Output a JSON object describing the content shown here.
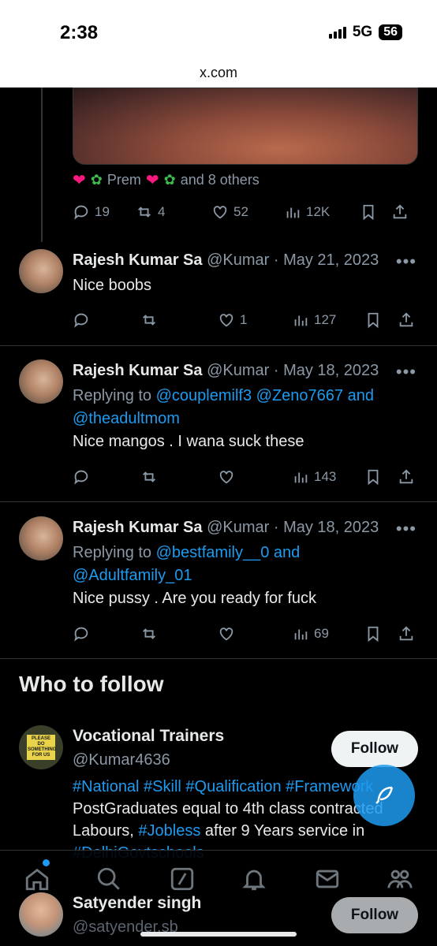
{
  "status_bar": {
    "time": "2:38",
    "network": "5G",
    "battery": "56"
  },
  "browser": {
    "url": "x.com"
  },
  "top_tweet": {
    "likers": {
      "name": "Prem",
      "suffix": "and 8 others"
    },
    "stats": {
      "replies": "19",
      "reposts": "4",
      "likes": "52",
      "views": "12K"
    }
  },
  "replies": [
    {
      "name": "Rajesh Kumar Sa",
      "handle": "@Kumar",
      "date": "· May 21, 2023",
      "text": "Nice boobs",
      "stats": {
        "replies": "",
        "reposts": "",
        "likes": "1",
        "views": "127"
      }
    },
    {
      "name": "Rajesh Kumar Sa",
      "handle": "@Kumar",
      "date": "· May 18, 2023",
      "replying_prefix": "Replying to",
      "replying_line1": "@couplemilf3 @Zeno7667 and",
      "replying_line2": "@theadultmom",
      "text": "Nice mangos . I wana suck these",
      "stats": {
        "replies": "",
        "reposts": "",
        "likes": "",
        "views": "143"
      }
    },
    {
      "name": "Rajesh Kumar Sa",
      "handle": "@Kumar",
      "date": "· May 18, 2023",
      "replying_prefix": "Replying to",
      "replying_line1": "@bestfamily__0 and",
      "replying_line2": "@Adultfamily_01",
      "text": "Nice pussy . Are you ready for fuck",
      "stats": {
        "replies": "",
        "reposts": "",
        "likes": "",
        "views": "69"
      }
    }
  ],
  "who_to_follow": {
    "title": "Who to follow",
    "follow_label": "Follow",
    "accounts": [
      {
        "name": "Vocational Trainers",
        "handle": "@Kumar4636",
        "avatar_text": "PLEASE DO SOMETHING FOR US",
        "bio_tags": "#National #Skill #Qualification #Framework",
        "bio_text_1": "PostGraduates equal to 4th class contracted",
        "bio_text_2": "Labours,",
        "bio_tag_2": "#Jobless",
        "bio_text_3": "after 9 Years service in",
        "bio_tag_3": "#DelhiGovtschools"
      },
      {
        "name": "Satyender singh",
        "handle": "@satyender.sb"
      }
    ]
  },
  "bottom_nav": [
    "home-icon",
    "search-icon",
    "grok-icon",
    "notifications-icon",
    "messages-icon",
    "communities-icon"
  ],
  "colors": {
    "link": "#1d9bf0",
    "like": "#f91880",
    "muted": "#8b98a5",
    "background": "#000000"
  }
}
